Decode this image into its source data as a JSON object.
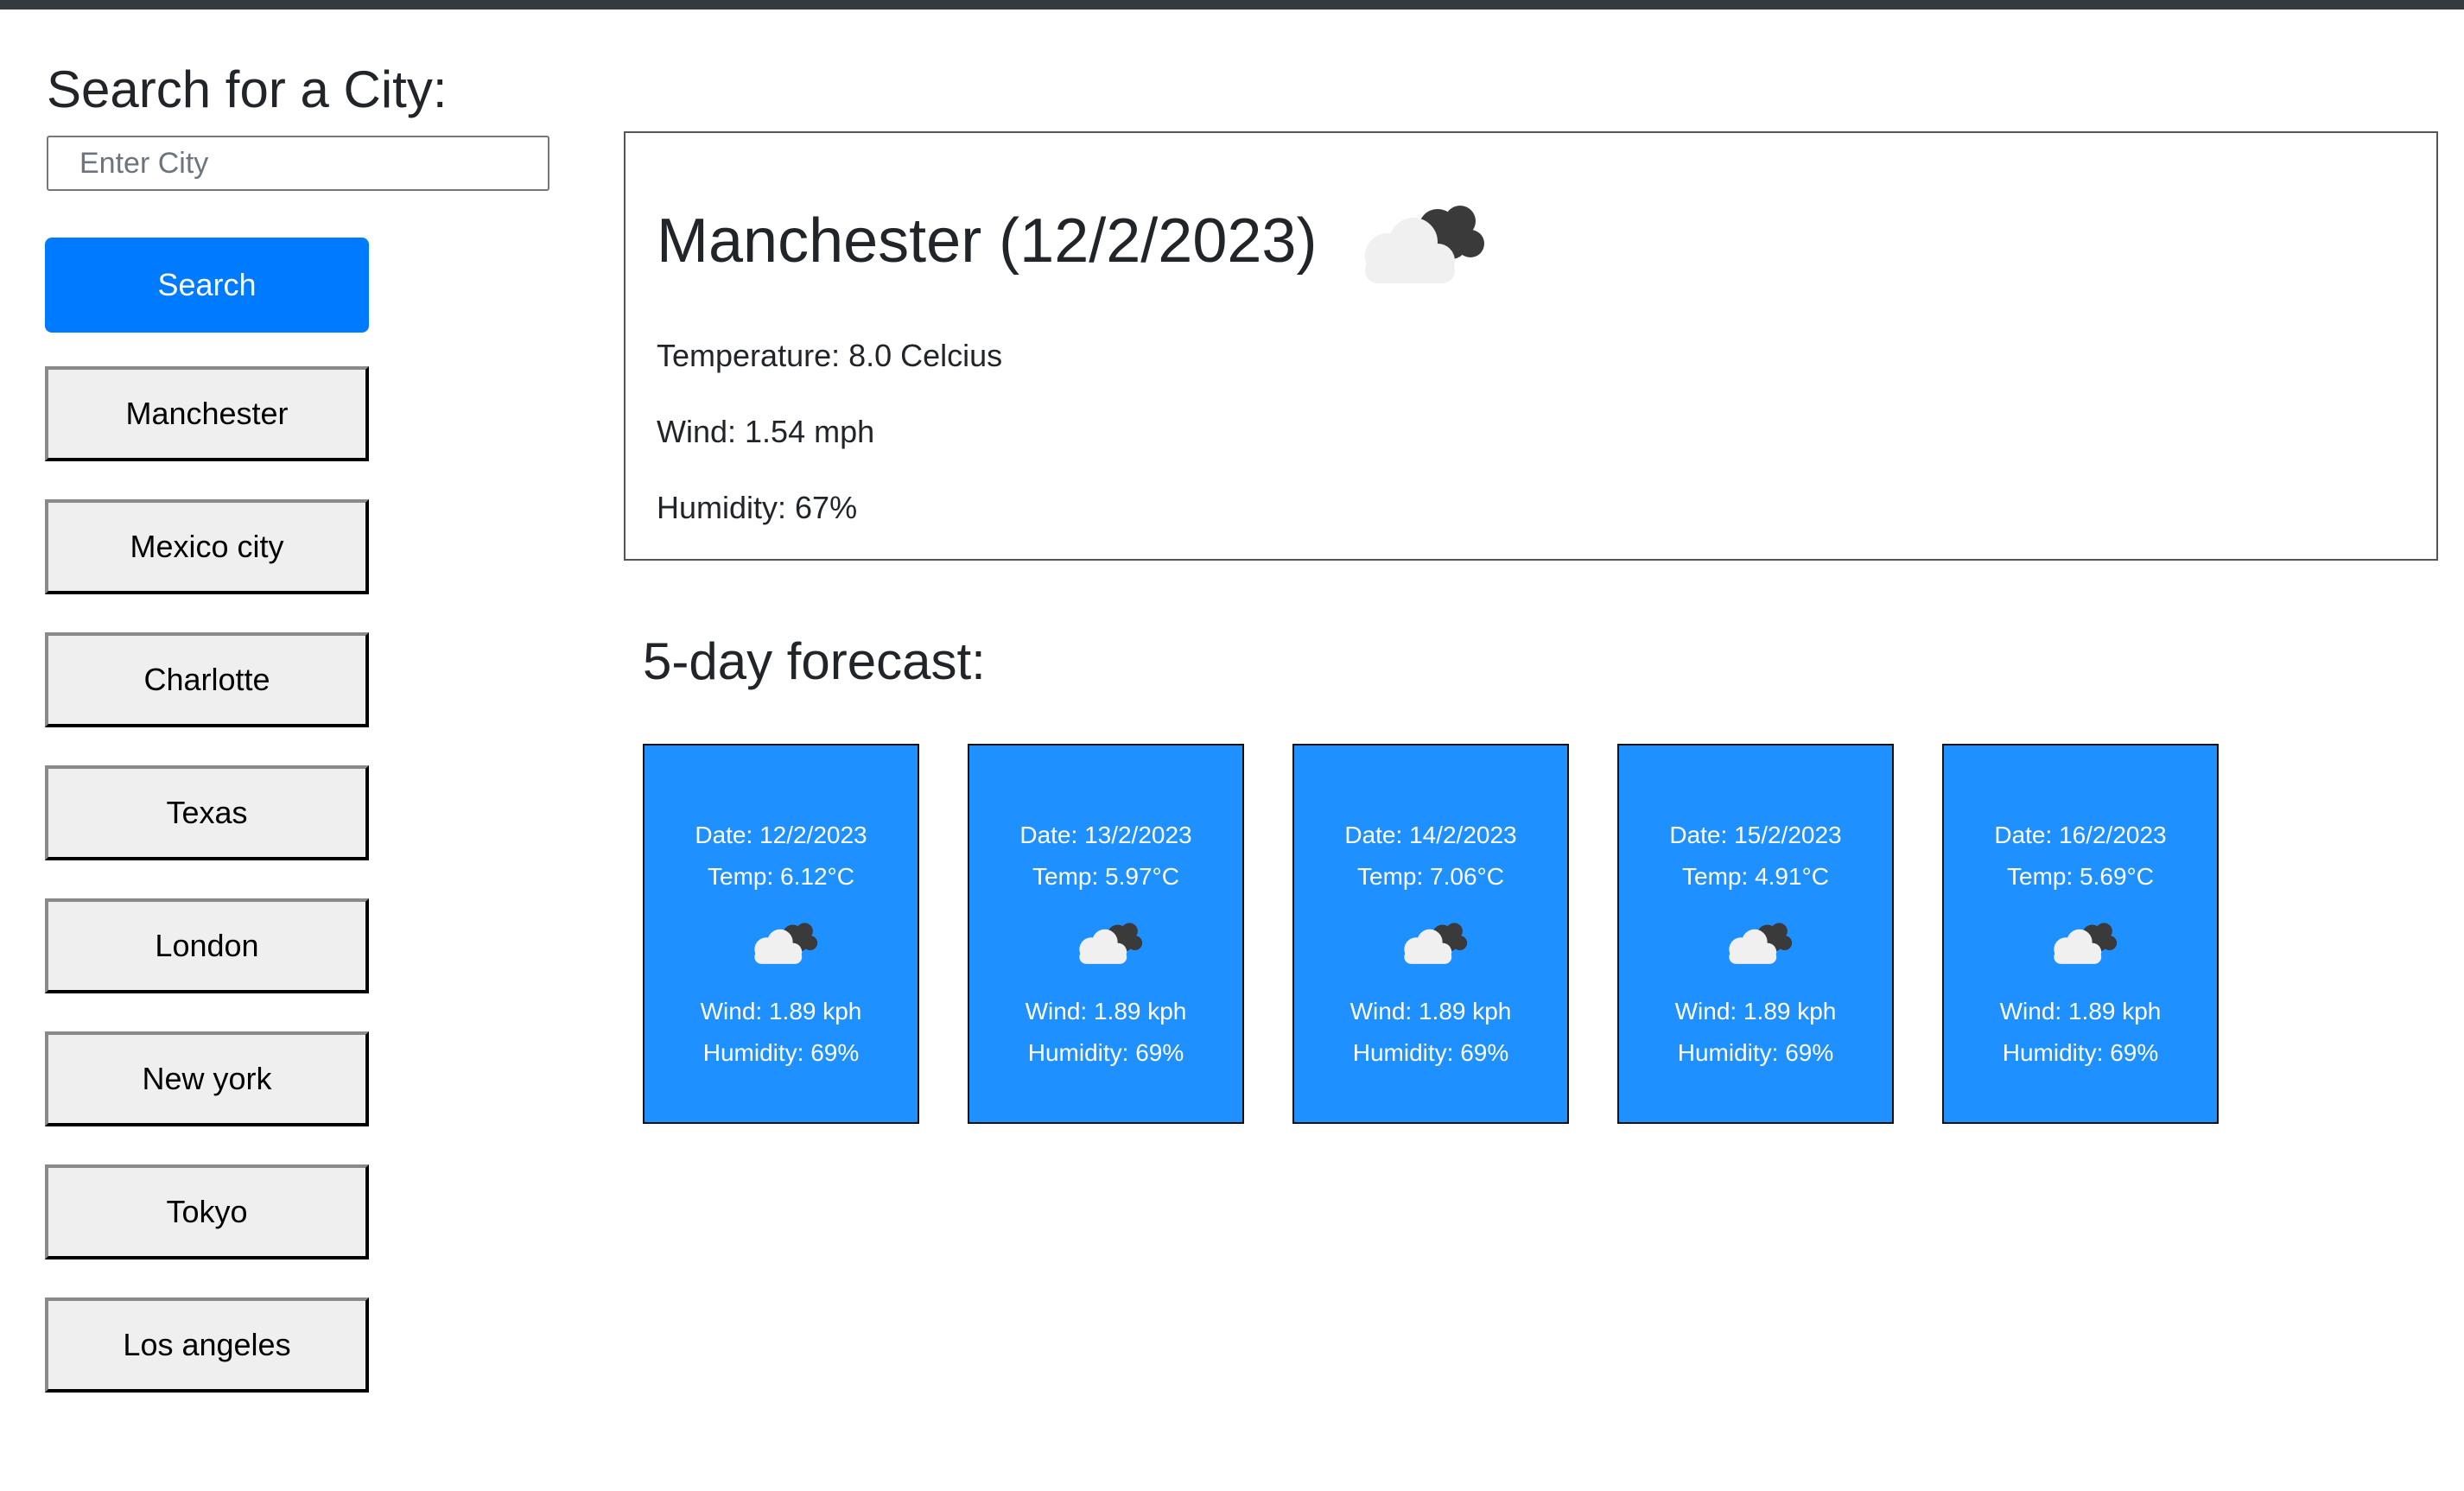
{
  "search": {
    "title": "Search for a City:",
    "placeholder": "Enter City",
    "value": "",
    "button_label": "Search",
    "button_color": "#007bff"
  },
  "history": [
    {
      "label": "Manchester"
    },
    {
      "label": "Mexico city"
    },
    {
      "label": "Charlotte"
    },
    {
      "label": "Texas"
    },
    {
      "label": "London"
    },
    {
      "label": "New york"
    },
    {
      "label": "Tokyo"
    },
    {
      "label": "Los angeles"
    }
  ],
  "current": {
    "title": "Manchester (12/2/2023)",
    "icon": "cloudy-icon",
    "temperature": "Temperature: 8.0 Celcius",
    "wind": "Wind: 1.54 mph",
    "humidity": "Humidity: 67%"
  },
  "forecast": {
    "title": "5-day forecast:",
    "card_color": "#1e90ff",
    "days": [
      {
        "date": "Date: 12/2/2023",
        "temp": "Temp: 6.12°C",
        "icon": "cloudy-icon",
        "wind": "Wind: 1.89 kph",
        "humidity": "Humidity: 69%"
      },
      {
        "date": "Date: 13/2/2023",
        "temp": "Temp: 5.97°C",
        "icon": "cloudy-icon",
        "wind": "Wind: 1.89 kph",
        "humidity": "Humidity: 69%"
      },
      {
        "date": "Date: 14/2/2023",
        "temp": "Temp: 7.06°C",
        "icon": "cloudy-icon",
        "wind": "Wind: 1.89 kph",
        "humidity": "Humidity: 69%"
      },
      {
        "date": "Date: 15/2/2023",
        "temp": "Temp: 4.91°C",
        "icon": "cloudy-icon",
        "wind": "Wind: 1.89 kph",
        "humidity": "Humidity: 69%"
      },
      {
        "date": "Date: 16/2/2023",
        "temp": "Temp: 5.69°C",
        "icon": "cloudy-icon",
        "wind": "Wind: 1.89 kph",
        "humidity": "Humidity: 69%"
      }
    ]
  }
}
